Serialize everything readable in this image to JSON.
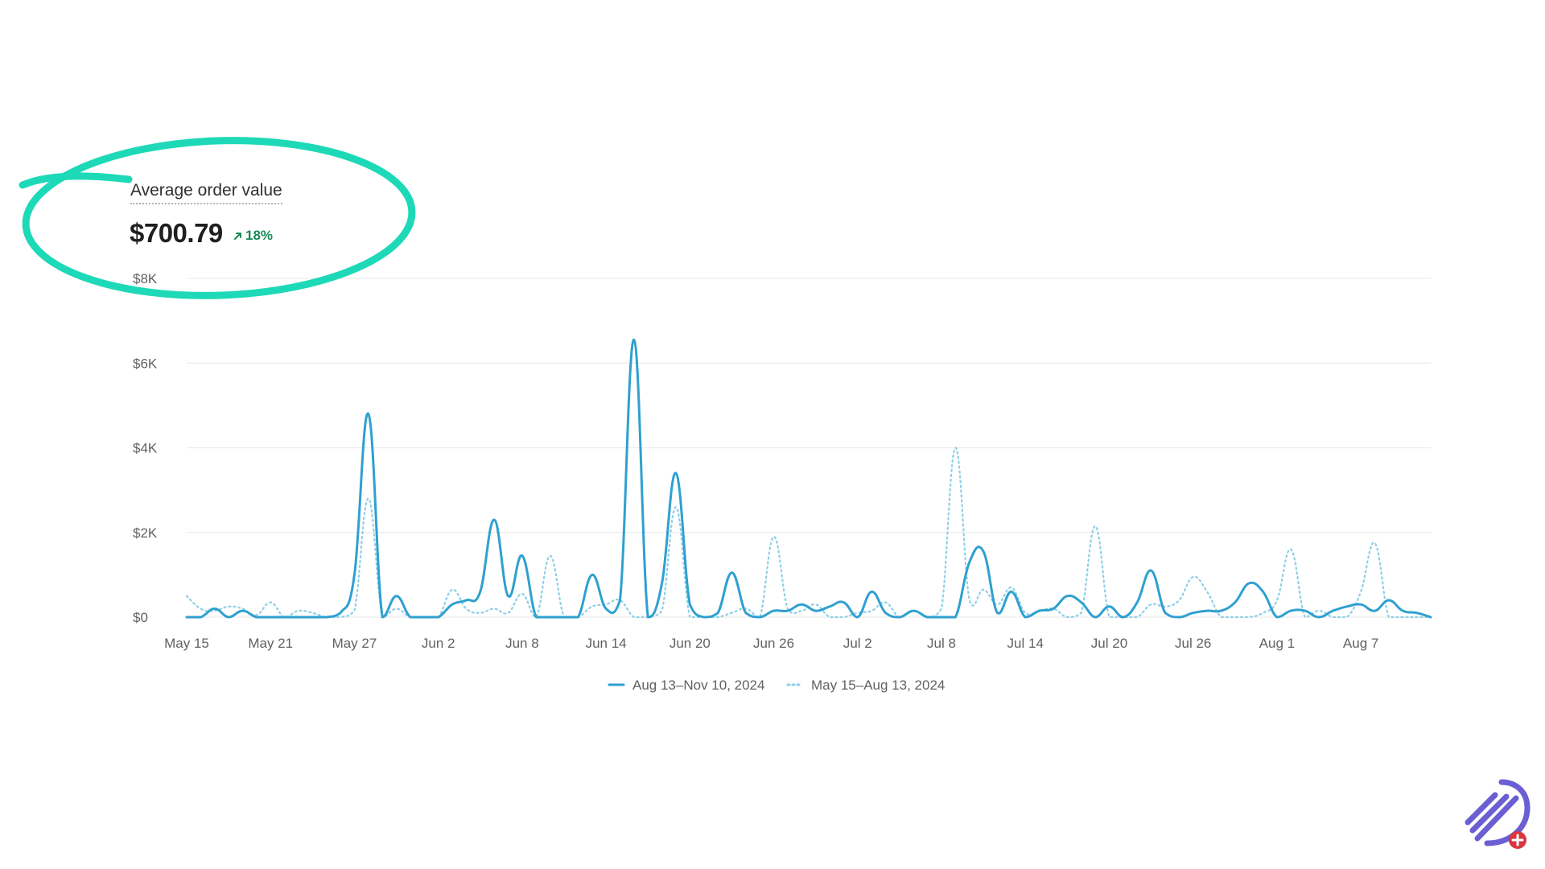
{
  "metric": {
    "title": "Average order value",
    "value": "$700.79",
    "change": "18%",
    "change_direction": "up",
    "change_color": "#1a8a55"
  },
  "colors": {
    "current_series": "#2fa0d0",
    "previous_series": "#8ecfe6",
    "highlight_ellipse": "#1ed9b7",
    "gridline": "#ececec",
    "axis_text": "#616161",
    "logo": "#6b5fd3",
    "logo_badge": "#d9363e"
  },
  "chart_data": {
    "type": "line",
    "title": "",
    "xlabel": "",
    "ylabel": "",
    "ylim": [
      0,
      8000
    ],
    "grid": true,
    "legend_position": "bottom-center",
    "yticks": [
      {
        "value": 0,
        "label": "$0"
      },
      {
        "value": 2000,
        "label": "$2K"
      },
      {
        "value": 4000,
        "label": "$4K"
      },
      {
        "value": 6000,
        "label": "$6K"
      },
      {
        "value": 8000,
        "label": "$8K"
      }
    ],
    "xticks": [
      {
        "index": 0,
        "label": "May 15"
      },
      {
        "index": 6,
        "label": "May 21"
      },
      {
        "index": 12,
        "label": "May 27"
      },
      {
        "index": 18,
        "label": "Jun 2"
      },
      {
        "index": 24,
        "label": "Jun 8"
      },
      {
        "index": 30,
        "label": "Jun 14"
      },
      {
        "index": 36,
        "label": "Jun 20"
      },
      {
        "index": 42,
        "label": "Jun 26"
      },
      {
        "index": 48,
        "label": "Jul 2"
      },
      {
        "index": 54,
        "label": "Jul 8"
      },
      {
        "index": 60,
        "label": "Jul 14"
      },
      {
        "index": 66,
        "label": "Jul 20"
      },
      {
        "index": 72,
        "label": "Jul 26"
      },
      {
        "index": 78,
        "label": "Aug 1"
      },
      {
        "index": 84,
        "label": "Aug 7"
      }
    ],
    "x": [
      "May 15",
      "May 16",
      "May 17",
      "May 18",
      "May 19",
      "May 20",
      "May 21",
      "May 22",
      "May 23",
      "May 24",
      "May 25",
      "May 26",
      "May 27",
      "May 28",
      "May 29",
      "May 30",
      "May 31",
      "Jun 1",
      "Jun 2",
      "Jun 3",
      "Jun 4",
      "Jun 5",
      "Jun 6",
      "Jun 7",
      "Jun 8",
      "Jun 9",
      "Jun 10",
      "Jun 11",
      "Jun 12",
      "Jun 13",
      "Jun 14",
      "Jun 15",
      "Jun 16",
      "Jun 17",
      "Jun 18",
      "Jun 19",
      "Jun 20",
      "Jun 21",
      "Jun 22",
      "Jun 23",
      "Jun 24",
      "Jun 25",
      "Jun 26",
      "Jun 27",
      "Jun 28",
      "Jun 29",
      "Jun 30",
      "Jul 1",
      "Jul 2",
      "Jul 3",
      "Jul 4",
      "Jul 5",
      "Jul 6",
      "Jul 7",
      "Jul 8",
      "Jul 9",
      "Jul 10",
      "Jul 11",
      "Jul 12",
      "Jul 13",
      "Jul 14",
      "Jul 15",
      "Jul 16",
      "Jul 17",
      "Jul 18",
      "Jul 19",
      "Jul 20",
      "Jul 21",
      "Jul 22",
      "Jul 23",
      "Jul 24",
      "Jul 25",
      "Jul 26",
      "Jul 27",
      "Jul 28",
      "Jul 29",
      "Jul 30",
      "Jul 31",
      "Aug 1",
      "Aug 2",
      "Aug 3",
      "Aug 4",
      "Aug 5",
      "Aug 6",
      "Aug 7",
      "Aug 8",
      "Aug 9",
      "Aug 10",
      "Aug 11",
      "Aug 12"
    ],
    "series": [
      {
        "name": "Aug 13–Nov 10, 2024",
        "style": "solid",
        "values": [
          0,
          0,
          200,
          0,
          150,
          0,
          0,
          0,
          0,
          0,
          0,
          100,
          1000,
          4800,
          0,
          500,
          0,
          0,
          0,
          300,
          400,
          600,
          2300,
          500,
          1450,
          0,
          0,
          0,
          0,
          1000,
          200,
          400,
          6550,
          0,
          800,
          3400,
          300,
          0,
          100,
          1050,
          100,
          0,
          150,
          150,
          300,
          150,
          250,
          350,
          0,
          600,
          100,
          0,
          150,
          0,
          0,
          0,
          1300,
          1550,
          100,
          600,
          0,
          150,
          200,
          500,
          350,
          0,
          250,
          0,
          350,
          1100,
          100,
          0,
          100,
          150,
          150,
          350,
          800,
          600,
          0,
          150,
          150,
          0,
          150,
          250,
          300,
          150,
          400,
          150,
          100,
          0
        ]
      },
      {
        "name": "May 15–Aug 13, 2024",
        "style": "dotted",
        "values": [
          500,
          200,
          150,
          250,
          200,
          50,
          350,
          0,
          150,
          100,
          0,
          0,
          150,
          2800,
          0,
          200,
          0,
          0,
          0,
          650,
          200,
          100,
          200,
          100,
          550,
          0,
          1450,
          0,
          0,
          250,
          300,
          400,
          0,
          0,
          150,
          2600,
          0,
          0,
          0,
          100,
          200,
          0,
          1900,
          200,
          150,
          300,
          0,
          0,
          100,
          150,
          350,
          0,
          150,
          0,
          200,
          4000,
          400,
          650,
          300,
          700,
          100,
          150,
          200,
          0,
          100,
          2150,
          0,
          0,
          0,
          300,
          250,
          400,
          950,
          600,
          0,
          0,
          0,
          100,
          400,
          1600,
          0,
          150,
          0,
          0,
          600,
          1750,
          0,
          0,
          0,
          0
        ]
      }
    ]
  }
}
